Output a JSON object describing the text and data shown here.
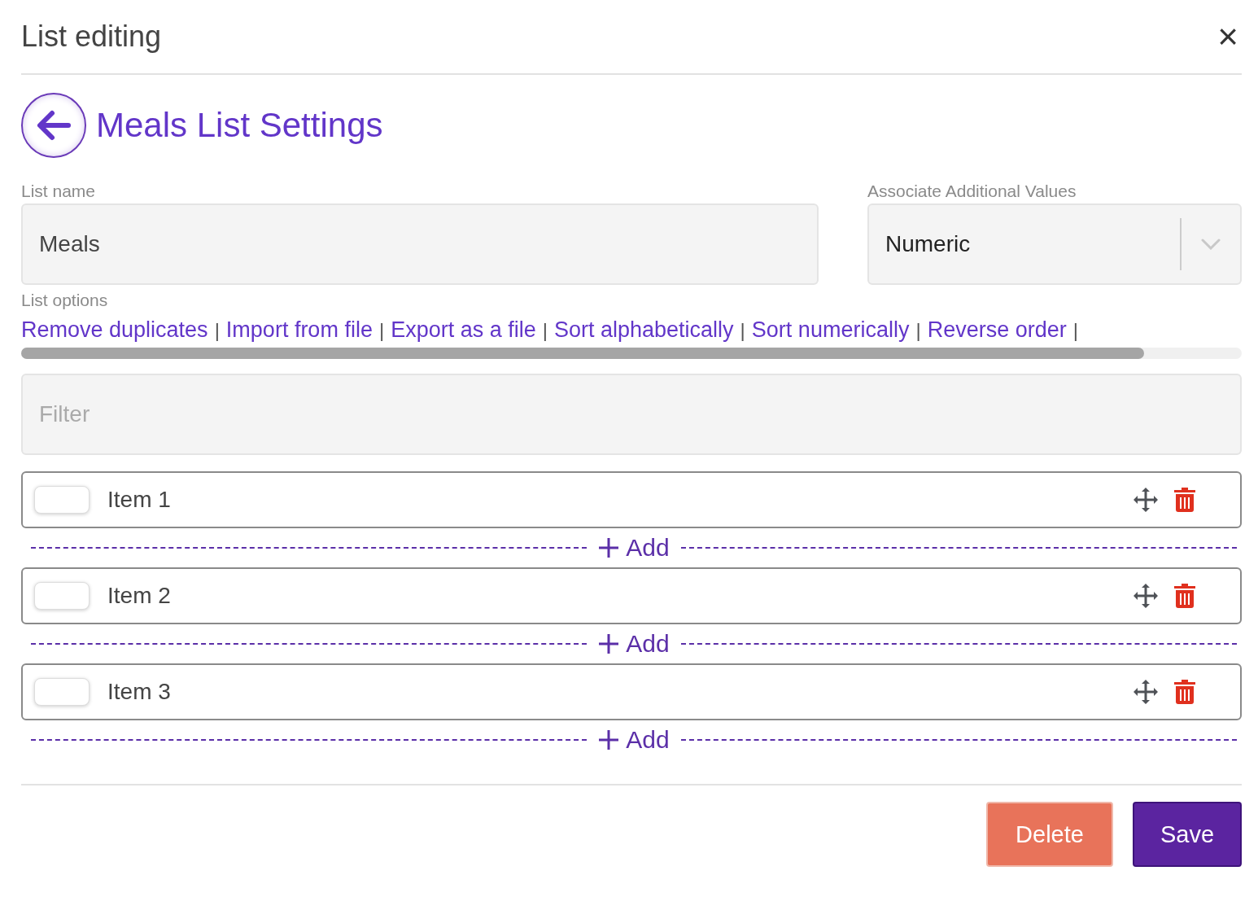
{
  "dialog": {
    "title": "List editing",
    "close": "×"
  },
  "header": {
    "title": "Meals List Settings"
  },
  "list_name": {
    "label": "List name",
    "value": "Meals"
  },
  "associate": {
    "label": "Associate Additional Values",
    "value": "Numeric"
  },
  "list_options": {
    "label": "List options",
    "separator": "|",
    "links": [
      "Remove duplicates",
      "Import from file",
      "Export as a file",
      "Sort alphabetically",
      "Sort numerically",
      "Reverse order"
    ]
  },
  "filter": {
    "placeholder": "Filter"
  },
  "items": [
    {
      "name": "Item 1",
      "add": "Add"
    },
    {
      "name": "Item 2",
      "add": "Add"
    },
    {
      "name": "Item 3",
      "add": "Add"
    }
  ],
  "buttons": [
    {
      "label": "Delete",
      "kind": "danger"
    },
    {
      "label": "Save",
      "kind": "primary"
    }
  ]
}
